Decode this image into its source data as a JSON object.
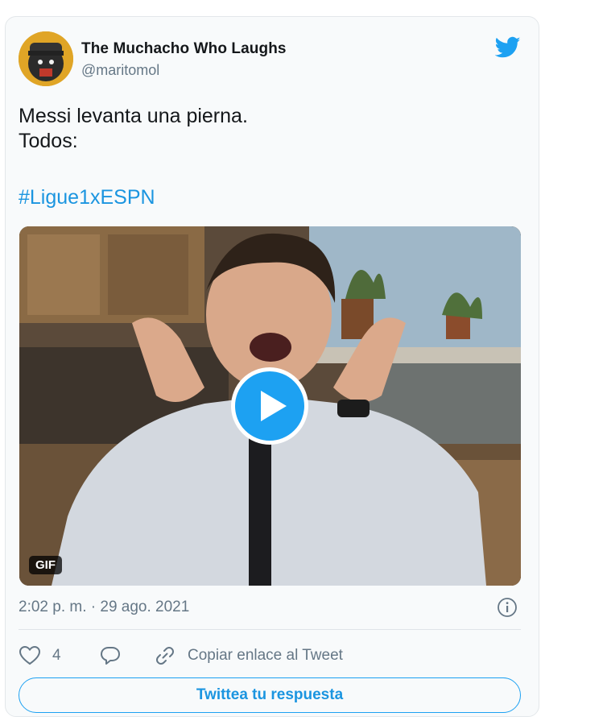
{
  "tweet": {
    "author_name": "The Muchacho Who Laughs",
    "author_handle": "@maritomol",
    "text_line1": "Messi levanta una pierna.",
    "text_line2": "Todos:",
    "hashtag": "#Ligue1xESPN",
    "media_badge": "GIF",
    "timestamp": "2:02 p. m. · 29 ago. 2021"
  },
  "actions": {
    "like_count": "4",
    "copy_link_label": "Copiar enlace al Tweet"
  },
  "reply_button_label": "Twittea tu respuesta",
  "icons": {
    "brand": "twitter-bird-icon",
    "like": "heart-icon",
    "reply": "speech-bubble-icon",
    "link": "link-icon",
    "info": "info-icon",
    "play": "play-icon"
  },
  "colors": {
    "brand": "#1da1f2",
    "link": "#1b95e0",
    "secondary_text": "#657786",
    "primary_text": "#14171a",
    "card_background": "#f8fafb"
  }
}
